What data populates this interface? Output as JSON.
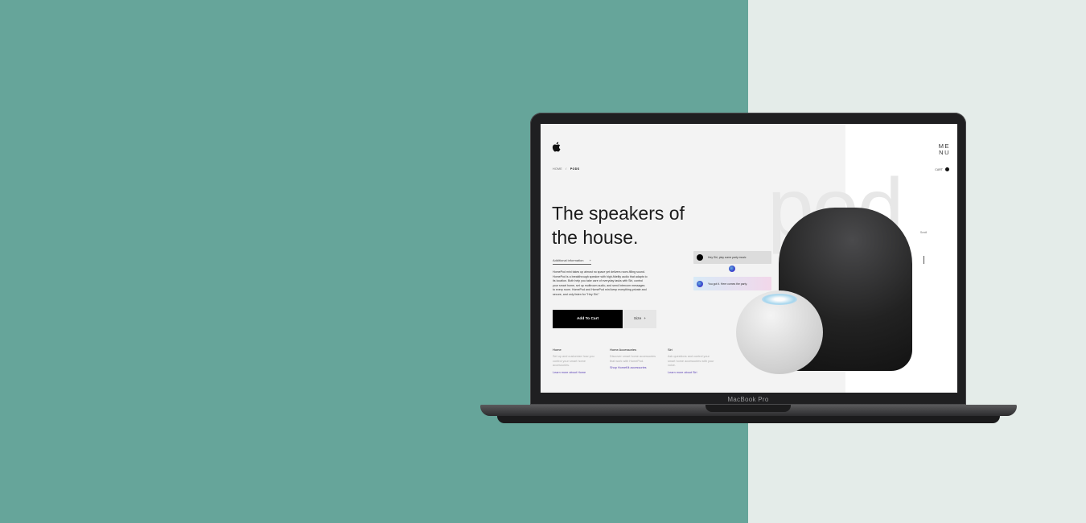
{
  "laptop": {
    "model_label": "MacBook Pro"
  },
  "site": {
    "menu_line1": "ME",
    "menu_line2": "NU",
    "breadcrumb_home": "HOME",
    "breadcrumb_sep": "/",
    "breadcrumb_current": "PODS",
    "cart_label": "CART",
    "watermark": "pod",
    "headline_line1": "The speakers of",
    "headline_line2": "the house.",
    "additional_info_label": "Additional information",
    "additional_info_icon": "+",
    "description": "HomePod mini takes up almost no space yet delivers room‑filling sound. HomePod is a breakthrough speaker with high‑fidelity audio that adapts to its location. Both help you take care of everyday tasks with Siri, control your smart home, set up multiroom audio, and send Intercom messages to every room. HomePod and HomePod mini keep everything private and secure, and only listen for \"Hey Siri.\"",
    "add_to_cart": "Add To Cart",
    "size_label": "Size",
    "size_icon": "+",
    "side_label": "Scroll",
    "columns": [
      {
        "title": "Home",
        "text": "Set up and customize how you control your smart home accessories.",
        "link": "Learn more about Home"
      },
      {
        "title": "Home Accessories",
        "text": "Discover smart home accessories that work with HomePod.",
        "link": "Shop HomeKit accessories"
      },
      {
        "title": "Siri",
        "text": "Ask questions and control your smart home accessories with your voice.",
        "link": "Learn more about Siri"
      }
    ],
    "chat_user": "Hey Siri, play some party music",
    "chat_siri": "You got it. Here comes the party."
  },
  "colors": {
    "left_bg": "#66a59a",
    "right_bg": "#e4ece9",
    "accent_link": "#5a3fb5"
  }
}
